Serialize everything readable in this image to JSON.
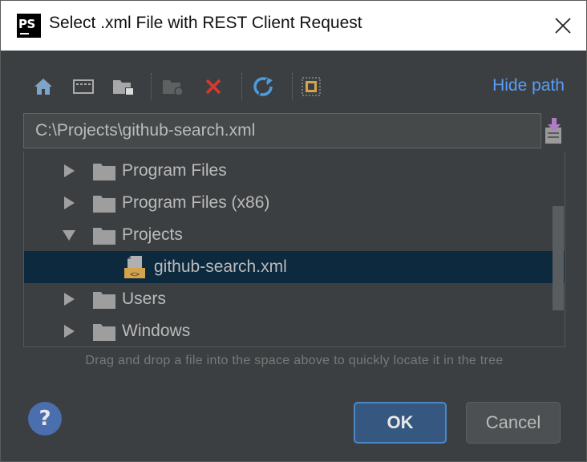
{
  "window": {
    "app_icon_text": "PS",
    "title": "Select .xml File with REST Client Request"
  },
  "toolbar": {
    "buttons": [
      {
        "icon": "home-icon"
      },
      {
        "icon": "desktop-icon"
      },
      {
        "icon": "project-folder-icon"
      },
      {
        "icon": "new-folder-icon",
        "disabled": true
      },
      {
        "icon": "delete-icon"
      },
      {
        "icon": "refresh-icon"
      },
      {
        "icon": "show-hidden-icon"
      }
    ],
    "hide_path_label": "Hide path"
  },
  "path": {
    "value": "C:\\Projects\\github-search.xml"
  },
  "tree": {
    "rows": [
      {
        "label": "Program Files",
        "type": "folder",
        "expanded": false,
        "depth": 0
      },
      {
        "label": "Program Files (x86)",
        "type": "folder",
        "expanded": false,
        "depth": 0
      },
      {
        "label": "Projects",
        "type": "folder",
        "expanded": true,
        "depth": 0
      },
      {
        "label": "github-search.xml",
        "type": "xml-file",
        "selected": true,
        "depth": 1
      },
      {
        "label": "Users",
        "type": "folder",
        "expanded": false,
        "depth": 0
      },
      {
        "label": "Windows",
        "type": "folder",
        "expanded": false,
        "depth": 0
      }
    ]
  },
  "hint": "Drag and drop a file into the space above to quickly locate it in the tree",
  "buttons": {
    "help_label": "?",
    "ok_label": "OK",
    "cancel_label": "Cancel"
  },
  "colors": {
    "background": "#3c3f41",
    "selection": "#0d293e",
    "link": "#589df6",
    "primary_button": "#365880",
    "delete": "#d9382f",
    "refresh": "#4b9de0",
    "download": "#b07bc6"
  }
}
